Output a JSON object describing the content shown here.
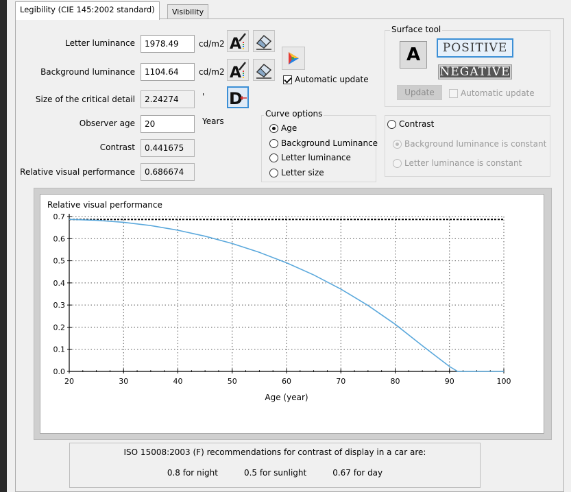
{
  "tabs": [
    {
      "label": "Legibility (CIE 145:2002 standard)"
    },
    {
      "label": "Visibility"
    }
  ],
  "form": {
    "letter_luminance": {
      "label": "Letter luminance",
      "value": "1978.49",
      "unit": "cd/m2"
    },
    "background_luminance": {
      "label": "Background luminance",
      "value": "1104.64",
      "unit": "cd/m2"
    },
    "critical_detail": {
      "label": "Size of the critical detail",
      "value": "2.24274",
      "unit": "'"
    },
    "observer_age": {
      "label": "Observer age",
      "value": "20",
      "unit": "Years"
    },
    "contrast": {
      "label": "Contrast",
      "value": "0.441675"
    },
    "rvp": {
      "label": "Relative visual performance",
      "value": "0.686674"
    }
  },
  "automatic_update": {
    "label": "Automatic update",
    "checked": true
  },
  "surface_tool": {
    "title": "Surface tool",
    "letter_button": "A",
    "positive_label": "POSITIVE",
    "negative_label": "NEGATIVE",
    "update_label": "Update",
    "auto_update_label": "Automatic update",
    "auto_update_checked": false
  },
  "curve_options": {
    "title": "Curve options",
    "options": [
      {
        "label": "Age",
        "checked": true
      },
      {
        "label": "Background Luminance",
        "checked": false
      },
      {
        "label": "Letter luminance",
        "checked": false
      },
      {
        "label": "Letter size",
        "checked": false
      }
    ]
  },
  "contrast_group": {
    "label": "Contrast",
    "checked": false,
    "options": [
      {
        "label": "Background luminance is constant",
        "checked": true
      },
      {
        "label": "Letter luminance is constant",
        "checked": false
      }
    ]
  },
  "icons": {
    "letter_picker": "letter-color-picker-icon",
    "eraser": "eraser-icon",
    "color_wheel": "color-triangle-icon",
    "detail": "detail-size-icon"
  },
  "colors": {
    "curve": "#5aa8dc",
    "positive_border": "#3b8fd6",
    "negative_bg": "#555555"
  },
  "chart_data": {
    "type": "line",
    "title": "",
    "ylabel": "Relative visual performance",
    "xlabel": "Age (year)",
    "xlim": [
      20,
      100
    ],
    "ylim": [
      0,
      0.7
    ],
    "xticks": [
      20,
      30,
      40,
      50,
      60,
      70,
      80,
      90,
      100
    ],
    "yticks": [
      0.0,
      0.1,
      0.2,
      0.3,
      0.4,
      0.5,
      0.6,
      0.7
    ],
    "ytick_labels": [
      "0.0",
      "0.1",
      "0.2",
      "0.3",
      "0.4",
      "0.5",
      "0.6",
      "0.7"
    ],
    "grid": true,
    "series": [
      {
        "x": [
          20,
          25,
          30,
          35,
          40,
          45,
          50,
          55,
          60,
          65,
          70,
          75,
          80,
          85,
          90,
          91.5,
          95,
          100
        ],
        "y": [
          0.687,
          0.683,
          0.674,
          0.659,
          0.638,
          0.611,
          0.578,
          0.538,
          0.491,
          0.436,
          0.372,
          0.298,
          0.213,
          0.116,
          0.022,
          0.0,
          0.0,
          0.0
        ]
      }
    ],
    "reference_line": {
      "y": 0.687
    }
  },
  "iso_note": {
    "title": "ISO 15008:2003 (F) recommendations for contrast of display in a car are:",
    "values": [
      "0.8 for night",
      "0.5 for sunlight",
      "0.67 for day"
    ]
  }
}
